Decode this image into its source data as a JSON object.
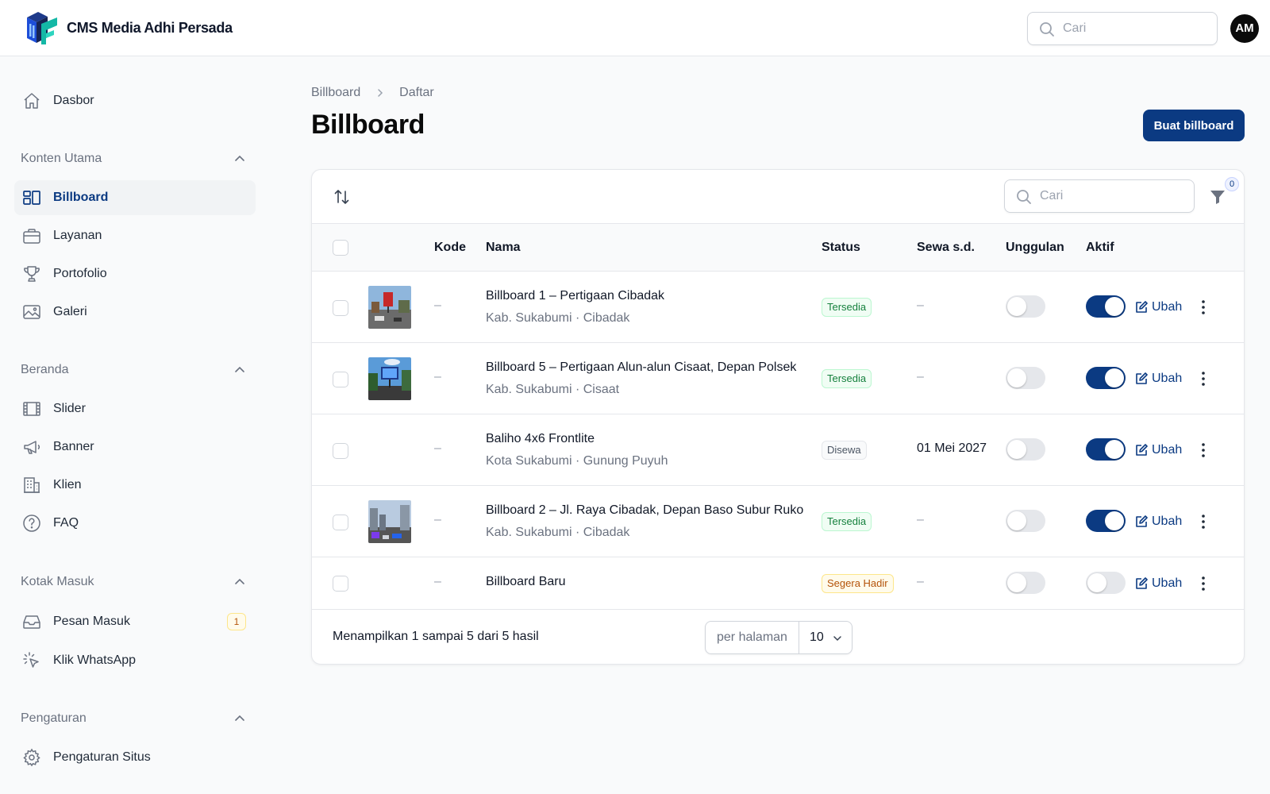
{
  "app": {
    "title": "CMS Media Adhi Persada",
    "user_initials": "AM",
    "search_placeholder": "Cari"
  },
  "sidebar": {
    "top_item": {
      "label": "Dasbor",
      "icon": "home-icon"
    },
    "groups": [
      {
        "label": "Konten Utama",
        "items": [
          {
            "label": "Billboard",
            "icon": "billboard-icon",
            "active": true
          },
          {
            "label": "Layanan",
            "icon": "briefcase-icon"
          },
          {
            "label": "Portofolio",
            "icon": "trophy-icon"
          },
          {
            "label": "Galeri",
            "icon": "image-icon"
          }
        ]
      },
      {
        "label": "Beranda",
        "items": [
          {
            "label": "Slider",
            "icon": "film-icon"
          },
          {
            "label": "Banner",
            "icon": "megaphone-icon"
          },
          {
            "label": "Klien",
            "icon": "building-icon"
          },
          {
            "label": "FAQ",
            "icon": "question-icon"
          }
        ]
      },
      {
        "label": "Kotak Masuk",
        "items": [
          {
            "label": "Pesan Masuk",
            "icon": "inbox-icon",
            "badge": "1"
          },
          {
            "label": "Klik WhatsApp",
            "icon": "cursor-click-icon"
          }
        ]
      },
      {
        "label": "Pengaturan",
        "items": [
          {
            "label": "Pengaturan Situs",
            "icon": "gear-icon"
          }
        ]
      }
    ]
  },
  "breadcrumb": [
    "Billboard",
    "Daftar"
  ],
  "page": {
    "title": "Billboard",
    "create_button": "Buat billboard"
  },
  "table": {
    "search_placeholder": "Cari",
    "filter_count": "0",
    "columns": {
      "code": "Kode",
      "name": "Nama",
      "status": "Status",
      "rent_until": "Sewa s.d.",
      "featured": "Unggulan",
      "active": "Aktif"
    },
    "edit_label": "Ubah",
    "rows": [
      {
        "code": "–",
        "name": "Billboard 1 – Pertigaan Cibadak",
        "location": "Kab. Sukabumi · Cibadak",
        "status": "Tersedia",
        "rent_until": "–",
        "featured": false,
        "active": true
      },
      {
        "code": "–",
        "name": "Billboard 5 – Pertigaan Alun-alun Cisaat, Depan Polsek",
        "location": "Kab. Sukabumi · Cisaat",
        "status": "Tersedia",
        "rent_until": "–",
        "featured": false,
        "active": true
      },
      {
        "code": "–",
        "name": "Baliho 4x6 Frontlite",
        "location": "Kota Sukabumi · Gunung Puyuh",
        "status": "Disewa",
        "rent_until": "01 Mei 2027",
        "featured": false,
        "active": true
      },
      {
        "code": "–",
        "name": "Billboard 2 – Jl. Raya Cibadak, Depan Baso Subur Ruko",
        "location": "Kab. Sukabumi · Cibadak",
        "status": "Tersedia",
        "rent_until": "–",
        "featured": false,
        "active": true
      },
      {
        "code": "–",
        "name": "Billboard Baru",
        "location": "",
        "status": "Segera Hadir",
        "rent_until": "–",
        "featured": false,
        "active": false
      }
    ],
    "footer": {
      "summary": "Menampilkan 1 sampai 5 dari 5 hasil",
      "per_page_label": "per halaman",
      "per_page_value": "10"
    }
  },
  "colors": {
    "primary": "#0b3a82",
    "success": "#15803d",
    "warning": "#b45309"
  }
}
